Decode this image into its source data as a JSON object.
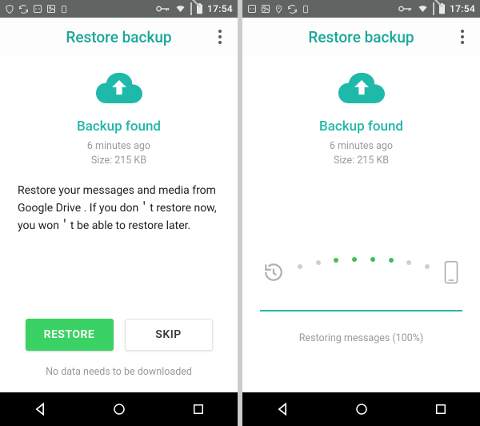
{
  "status": {
    "time": "17:54"
  },
  "header": {
    "title": "Restore backup"
  },
  "backup": {
    "title": "Backup found",
    "age": "6 minutes ago",
    "size": "Size: 215 KB"
  },
  "left": {
    "description": "Restore your messages and media from Google Drive . If you don＇t restore now, you won＇t be able to restore later.",
    "restore_label": "RESTORE",
    "skip_label": "SKIP",
    "footer": "No data needs to be downloaded"
  },
  "right": {
    "status": "Restoring messages (100%)"
  }
}
